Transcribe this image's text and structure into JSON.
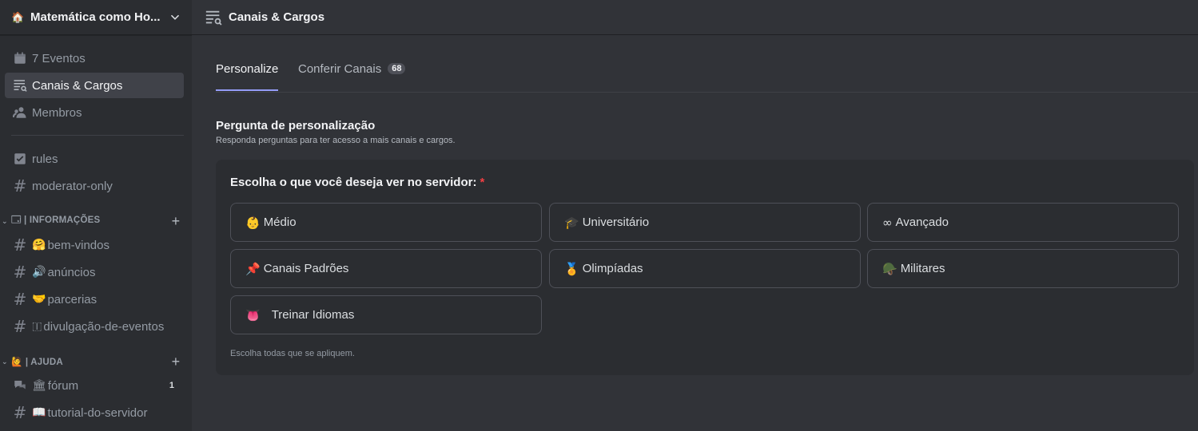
{
  "server": {
    "icon": "🏠",
    "name": "Matemática como Ho..."
  },
  "sidebar": {
    "nav": [
      {
        "icon": "calendar-icon",
        "label": "7 Eventos"
      },
      {
        "icon": "channels-roles-icon",
        "label": "Canais & Cargos"
      },
      {
        "icon": "members-icon",
        "label": "Membros"
      }
    ],
    "channels_top": [
      {
        "icon": "rules-icon",
        "label": "rules"
      },
      {
        "icon": "hash-lock-icon",
        "label": "moderator-only"
      }
    ],
    "categories": [
      {
        "label": "🗔 | INFORMAÇÕES",
        "channels": [
          {
            "emoji": "🤗",
            "label": "bem-vindos"
          },
          {
            "emoji": "🔊",
            "label": "anúncios"
          },
          {
            "emoji": "🤝",
            "label": "parcerias"
          },
          {
            "emoji": "🇮",
            "label": "divulgação-de-eventos"
          }
        ]
      },
      {
        "label": "🙋 | AJUDA",
        "channels": [
          {
            "emoji": "🏛",
            "label": "fórum",
            "count": "1"
          },
          {
            "emoji": "📖",
            "label": "tutorial-do-servidor"
          }
        ]
      }
    ]
  },
  "topbar": {
    "title": "Canais & Cargos"
  },
  "tabs": [
    {
      "label": "Personalize"
    },
    {
      "label": "Conferir Canais",
      "badge": "68"
    }
  ],
  "section": {
    "title": "Pergunta de personalização",
    "subtitle": "Responda perguntas para ter acesso a mais canais e cargos."
  },
  "question": {
    "title": "Escolha o que você deseja ver no servidor:",
    "required_mark": "*",
    "options": [
      {
        "emoji": "👶",
        "label": "Médio"
      },
      {
        "emoji": "🎓",
        "label": "Universitário"
      },
      {
        "emoji": "∞",
        "label": "Avançado"
      },
      {
        "emoji": "📌",
        "label": "Canais Padrões"
      },
      {
        "emoji": "🏅",
        "label": "Olimpíadas"
      },
      {
        "emoji": "🪖",
        "label": "Militares"
      },
      {
        "emoji": "👅",
        "label": "Treinar Idiomas"
      }
    ],
    "hint": "Escolha todas que se apliquem."
  }
}
